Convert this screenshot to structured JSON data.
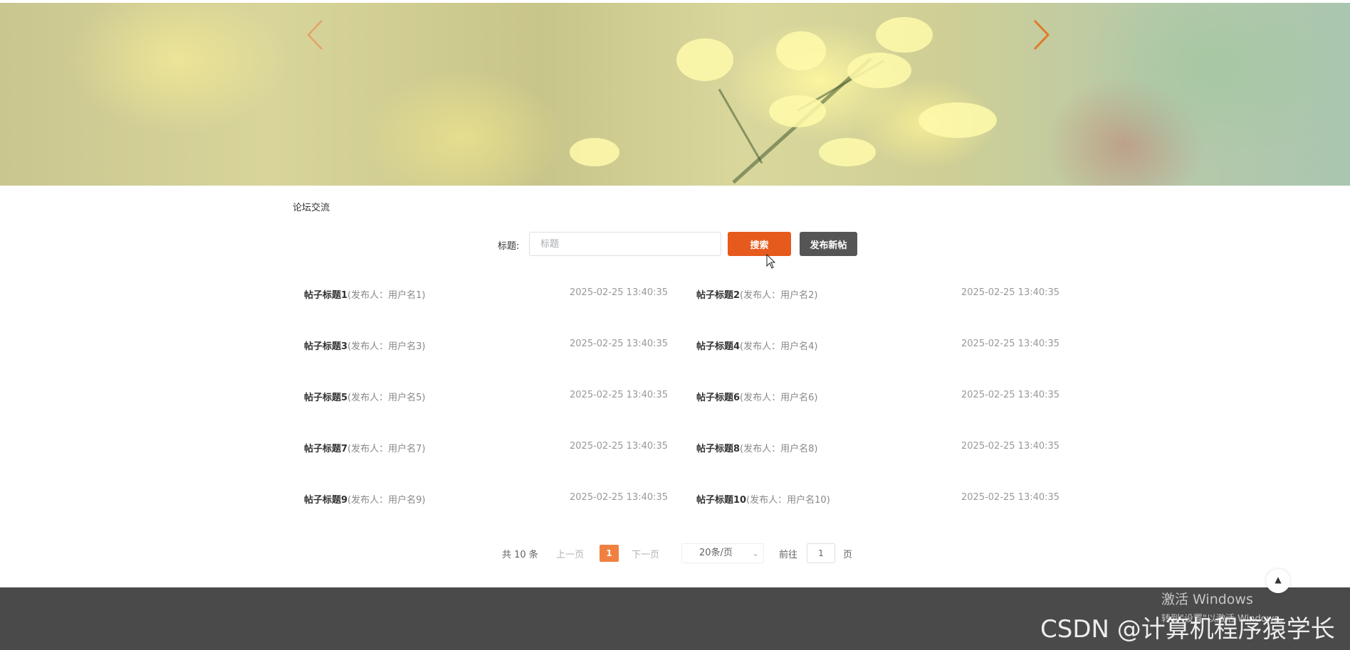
{
  "section": {
    "title": "论坛交流"
  },
  "search": {
    "label": "标题:",
    "placeholder": "标题",
    "value": "",
    "search_button": "搜索",
    "post_button": "发布新帖"
  },
  "posts": [
    {
      "title": "帖子标题1",
      "author": "(发布人：用户名1)",
      "date": "2025-02-25 13:40:35"
    },
    {
      "title": "帖子标题2",
      "author": "(发布人：用户名2)",
      "date": "2025-02-25 13:40:35"
    },
    {
      "title": "帖子标题3",
      "author": "(发布人：用户名3)",
      "date": "2025-02-25 13:40:35"
    },
    {
      "title": "帖子标题4",
      "author": "(发布人：用户名4)",
      "date": "2025-02-25 13:40:35"
    },
    {
      "title": "帖子标题5",
      "author": "(发布人：用户名5)",
      "date": "2025-02-25 13:40:35"
    },
    {
      "title": "帖子标题6",
      "author": "(发布人：用户名6)",
      "date": "2025-02-25 13:40:35"
    },
    {
      "title": "帖子标题7",
      "author": "(发布人：用户名7)",
      "date": "2025-02-25 13:40:35"
    },
    {
      "title": "帖子标题8",
      "author": "(发布人：用户名8)",
      "date": "2025-02-25 13:40:35"
    },
    {
      "title": "帖子标题9",
      "author": "(发布人：用户名9)",
      "date": "2025-02-25 13:40:35"
    },
    {
      "title": "帖子标题10",
      "author": "(发布人：用户名10)",
      "date": "2025-02-25 13:40:35"
    }
  ],
  "pagination": {
    "total": "共 10 条",
    "prev": "上一页",
    "current": "1",
    "next": "下一页",
    "page_size": "20条/页",
    "goto": "前往",
    "goto_value": "1",
    "page_suffix": "页"
  },
  "overlay": {
    "activate_title": "激活 Windows",
    "activate_sub": "转到\"设置\"以激活 Windows。",
    "watermark": "CSDN @计算机程序猿学长"
  },
  "icons": {
    "carousel_prev": "chevron-left-icon",
    "carousel_next": "chevron-right-icon",
    "back_to_top": "caret-up-icon",
    "page_size_dropdown": "chevron-down-icon"
  },
  "colors": {
    "accent": "#e65a1d",
    "post_button": "#555555",
    "current_page": "#f08040",
    "footer": "#4a4a4a",
    "carousel_arrow": "#e07a2a"
  }
}
